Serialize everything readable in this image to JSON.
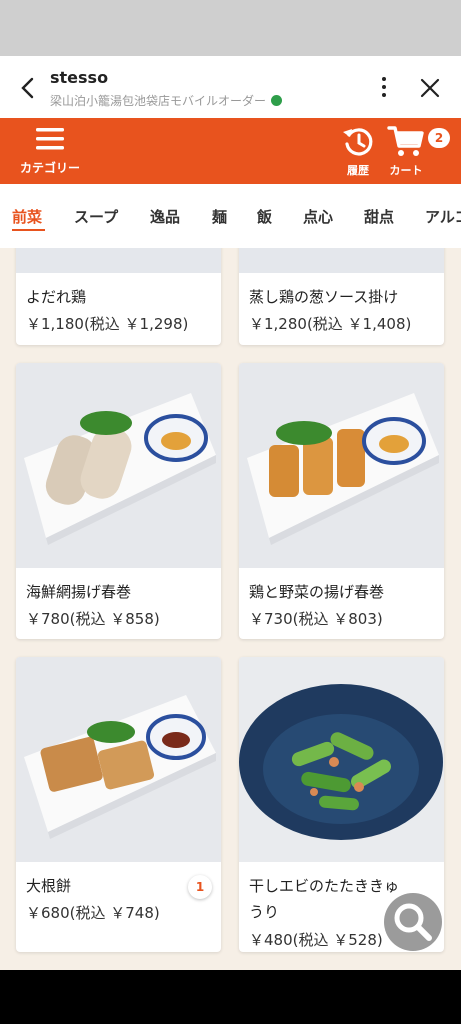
{
  "header": {
    "title": "stesso",
    "subtitle": "梁山泊小籠湯包池袋店モバイルオーダー"
  },
  "toolbar": {
    "category_label": "カテゴリー",
    "history_label": "履歴",
    "cart_label": "カート",
    "cart_count": "2"
  },
  "tabs": [
    {
      "label": "前菜",
      "active": true
    },
    {
      "label": "スープ"
    },
    {
      "label": "逸品"
    },
    {
      "label": "麺"
    },
    {
      "label": "飯"
    },
    {
      "label": "点心"
    },
    {
      "label": "甜点"
    },
    {
      "label": "アルコ"
    }
  ],
  "items": [
    {
      "name": "よだれ鶏",
      "price": "￥1,180(税込 ￥1,298)"
    },
    {
      "name": "蒸し鶏の葱ソース掛け",
      "price": "￥1,280(税込 ￥1,408)"
    },
    {
      "name": "海鮮網揚げ春巻",
      "price": "￥780(税込 ￥858)"
    },
    {
      "name": "鶏と野菜の揚げ春巻",
      "price": "￥730(税込 ￥803)"
    },
    {
      "name": "大根餅",
      "price": "￥680(税込 ￥748)",
      "qty": "1"
    },
    {
      "name_line1": "干しエビのたたききゅ",
      "name_line2": "うり",
      "price": "￥480(税込 ￥528)"
    }
  ],
  "colors": {
    "accent": "#e8531e",
    "background": "#f6efe6"
  },
  "icons": {
    "back": "chevron-left-icon",
    "more": "more-vertical-icon",
    "close": "close-icon",
    "category": "hamburger-icon",
    "history": "history-icon",
    "cart": "cart-icon",
    "search": "search-icon"
  }
}
